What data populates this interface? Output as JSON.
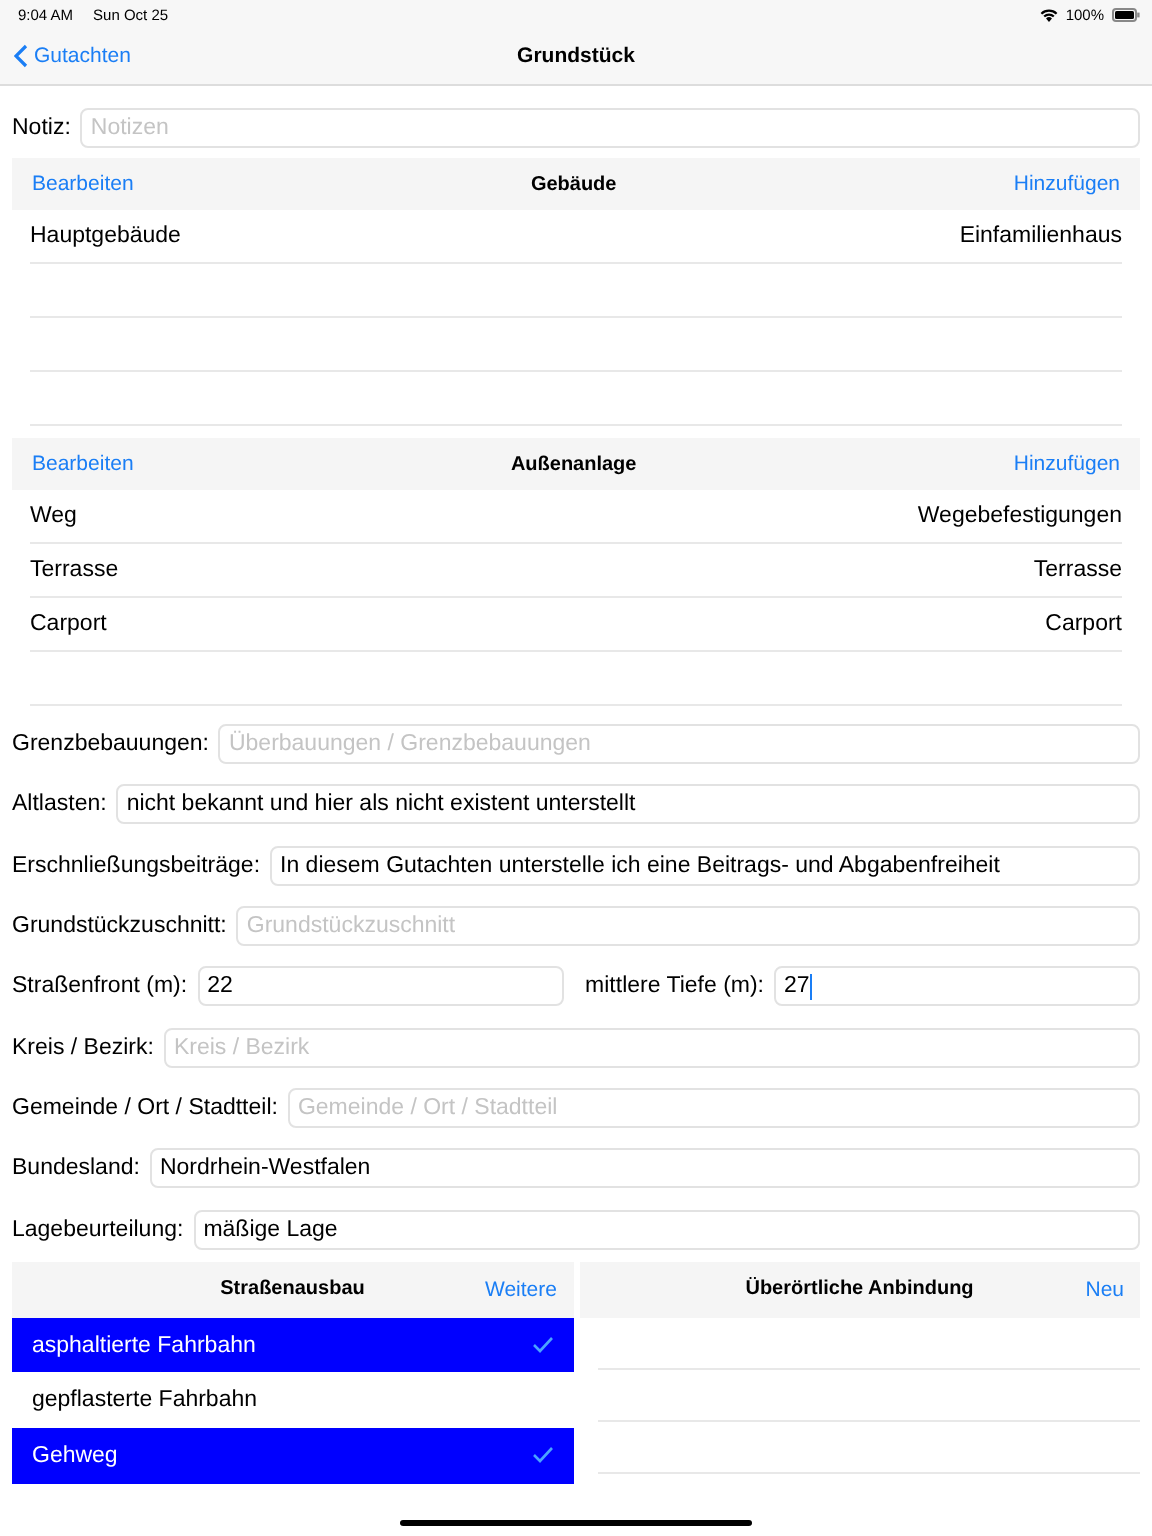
{
  "status_bar": {
    "time": "9:04 AM",
    "date": "Sun Oct 25",
    "battery": "100%"
  },
  "nav": {
    "back": "Gutachten",
    "title": "Grundstück"
  },
  "note": {
    "label": "Notiz:",
    "placeholder": "Notizen"
  },
  "buildings": {
    "edit": "Bearbeiten",
    "title": "Gebäude",
    "add": "Hinzufügen",
    "rows": [
      {
        "name": "Hauptgebäude",
        "type": "Einfamilienhaus"
      }
    ]
  },
  "outdoor": {
    "edit": "Bearbeiten",
    "title": "Außenanlage",
    "add": "Hinzufügen",
    "rows": [
      {
        "name": "Weg",
        "type": "Wegebefestigungen"
      },
      {
        "name": "Terrasse",
        "type": "Terrasse"
      },
      {
        "name": "Carport",
        "type": "Carport"
      }
    ]
  },
  "fields": [
    {
      "label": "Grenzbebauungen:",
      "placeholder": "Überbauungen / Grenzbebauungen"
    },
    {
      "label": "Altlasten:",
      "value": "nicht bekannt und hier als nicht existent unterstellt"
    },
    {
      "label": "Erschnließungsbeiträge:",
      "value": "In diesem Gutachten unterstelle ich eine Beitrags- und Abgabenfreiheit"
    },
    {
      "label": "Grundstückzuschnitt:",
      "placeholder": "Grundstückzuschnitt"
    },
    {
      "label": "Straßenfront (m):",
      "value": "22",
      "second": {
        "label": "mittlere Tiefe (m):",
        "value": "27",
        "focused": true
      }
    },
    {
      "label": "Kreis / Bezirk:",
      "placeholder": "Kreis / Bezirk"
    },
    {
      "label": "Gemeinde / Ort / Stadtteil:",
      "placeholder": "Gemeinde / Ort / Stadtteil"
    },
    {
      "label": "Bundesland:",
      "value": "Nordrhein-Westfalen"
    },
    {
      "label": "Lagebeurteilung:",
      "value": "mäßige Lage"
    }
  ],
  "street": {
    "title": "Straßenausbau",
    "action": "Weitere",
    "items": [
      {
        "label": "asphaltierte Fahrbahn",
        "selected": true
      },
      {
        "label": "gepflasterte Fahrbahn",
        "selected": false
      },
      {
        "label": "Gehweg",
        "selected": true
      }
    ]
  },
  "connection": {
    "title": "Überörtliche Anbindung",
    "action": "Neu"
  }
}
